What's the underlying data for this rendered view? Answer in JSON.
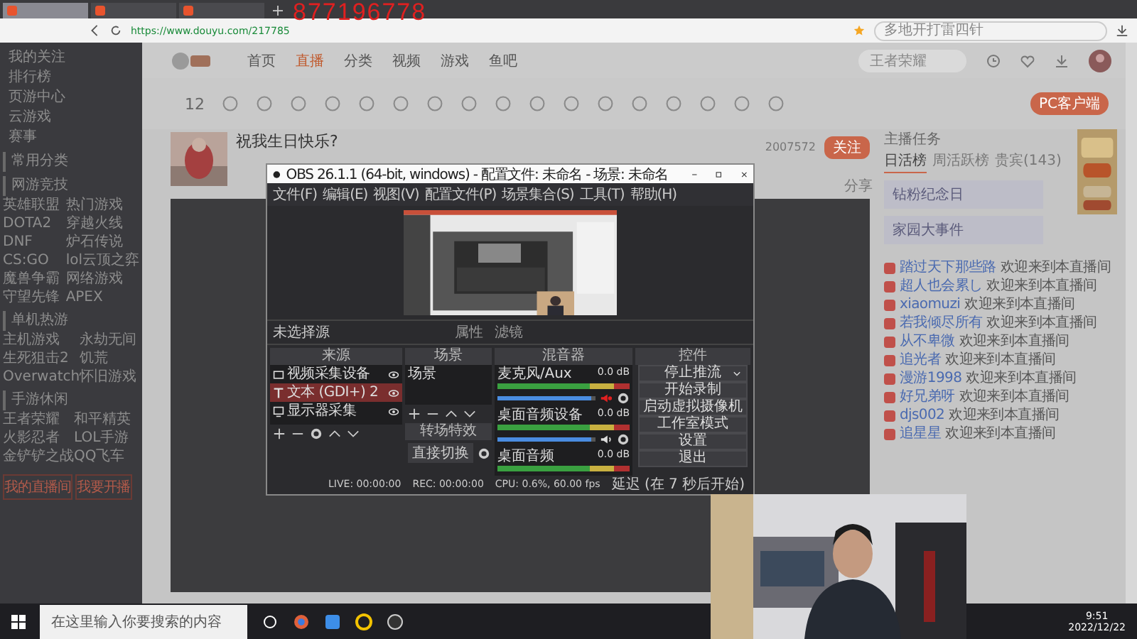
{
  "overlay_text": "877196778",
  "browser": {
    "tabs": [
      {
        "selected": true
      },
      {
        "selected": false
      },
      {
        "selected": false
      }
    ],
    "url": "https://www.douyu.com/217785",
    "search_placeholder": "多地开打雷四针"
  },
  "site": {
    "nav": [
      {
        "label": "首页",
        "selected": false
      },
      {
        "label": "直播",
        "selected": true
      },
      {
        "label": "分类",
        "selected": false
      },
      {
        "label": "视频",
        "selected": false
      },
      {
        "label": "游戏",
        "selected": false
      },
      {
        "label": "鱼吧",
        "selected": false
      }
    ],
    "search_placeholder": "王者荣耀",
    "follow_count": "12",
    "client_button": "PC客户端",
    "sidebar": {
      "top_items": [
        {
          "label": "我的关注"
        },
        {
          "label": "排行榜"
        },
        {
          "label": "页游中心"
        },
        {
          "label": "云游戏"
        },
        {
          "label": "赛事"
        }
      ],
      "sections": [
        {
          "title": "常用分类"
        },
        {
          "title": "网游竞技",
          "items": [
            "英雄联盟",
            "热门游戏",
            "DOTA2",
            "穿越火线",
            "DNF",
            "炉石传说",
            "CS:GO",
            "lol云顶之弈",
            "魔兽争霸",
            "网络游戏",
            "守望先锋",
            "APEX"
          ]
        },
        {
          "title": "单机热游",
          "items": [
            "主机游戏",
            "永劫无间",
            "生死狙击2",
            "饥荒",
            "Overwatch",
            "怀旧游戏"
          ]
        },
        {
          "title": "手游休闲",
          "items": [
            "王者荣耀",
            "和平精英",
            "火影忍者",
            "LOL手游",
            "金铲铲之战",
            "QQ飞车"
          ]
        }
      ],
      "buttons": [
        "我的直播间",
        "我要开播"
      ]
    },
    "room": {
      "title": "祝我生日快乐?",
      "count": "2007572",
      "follow": "关注",
      "share": "分享"
    },
    "chat": {
      "task": "主播任务",
      "tabs": [
        {
          "label": "日活榜",
          "selected": true
        },
        {
          "label": "周活跃榜",
          "selected": false
        },
        {
          "label": "贵宾(143)",
          "selected": false
        }
      ],
      "cards": [
        "钻粉纪念日",
        "家园大事件"
      ],
      "messages": [
        {
          "name": "踏过天下那些路",
          "text": "欢迎来到本直播间"
        },
        {
          "name": "超人也会累し",
          "text": "欢迎来到本直播间"
        },
        {
          "name": "xiaomuzi",
          "text": "欢迎来到本直播间"
        },
        {
          "name": "若我倾尽所有",
          "text": "欢迎来到本直播间"
        },
        {
          "name": "从不卑微",
          "text": "欢迎来到本直播间"
        },
        {
          "name": "追光者",
          "text": "欢迎来到本直播间"
        },
        {
          "name": "漫游1998",
          "text": "欢迎来到本直播间"
        },
        {
          "name": "好兄弟呀",
          "text": "欢迎来到本直播间"
        },
        {
          "name": "djs002",
          "text": "欢迎来到本直播间"
        },
        {
          "name": "追星星",
          "text": "欢迎来到本直播间"
        }
      ]
    }
  },
  "obs": {
    "title": "OBS 26.1.1 (64-bit, windows) - 配置文件: 未命名 - 场景: 未命名",
    "menu": [
      "文件(F)",
      "编辑(E)",
      "视图(V)",
      "配置文件(P)",
      "场景集合(S)",
      "工具(T)",
      "帮助(H)"
    ],
    "no_source": "未选择源",
    "props": [
      "属性",
      "滤镜"
    ],
    "docks": {
      "sources": "来源",
      "scenes": "场景",
      "mixer": "混音器",
      "controls": "控件",
      "transitions": "转场特效"
    },
    "sources": [
      {
        "kind": "camera",
        "label": "视频采集设备",
        "selected": false
      },
      {
        "kind": "text",
        "label": "文本 (GDI+) 2",
        "selected": true
      },
      {
        "kind": "monitor",
        "label": "显示器采集",
        "selected": false
      }
    ],
    "scenes": [
      {
        "label": "场景",
        "selected": false
      }
    ],
    "channels": [
      {
        "name": "麦克风/Aux",
        "reading": "0.0 dB",
        "level": 0.95,
        "muted": true
      },
      {
        "name": "桌面音频设备",
        "reading": "0.0 dB",
        "level": 0.95,
        "muted": false
      },
      {
        "name": "桌面音频",
        "reading": "0.0 dB"
      }
    ],
    "transition": "直接切换",
    "controls": [
      {
        "label": "停止推流",
        "menu": true
      },
      {
        "label": "开始录制",
        "menu": false
      },
      {
        "label": "启动虚拟摄像机",
        "menu": false
      },
      {
        "label": "工作室模式",
        "menu": false
      },
      {
        "label": "设置",
        "menu": false
      },
      {
        "label": "退出",
        "menu": false
      }
    ],
    "status": {
      "live": "LIVE: 00:00:00",
      "rec": "REC: 00:00:00",
      "cpu": "CPU: 0.6%, 60.00 fps",
      "delay": "延迟 (在 7 秒后开始)"
    }
  },
  "taskbar": {
    "search_placeholder": "在这里输入你要搜索的内容",
    "time": "9:51",
    "date": "2022/12/22"
  }
}
